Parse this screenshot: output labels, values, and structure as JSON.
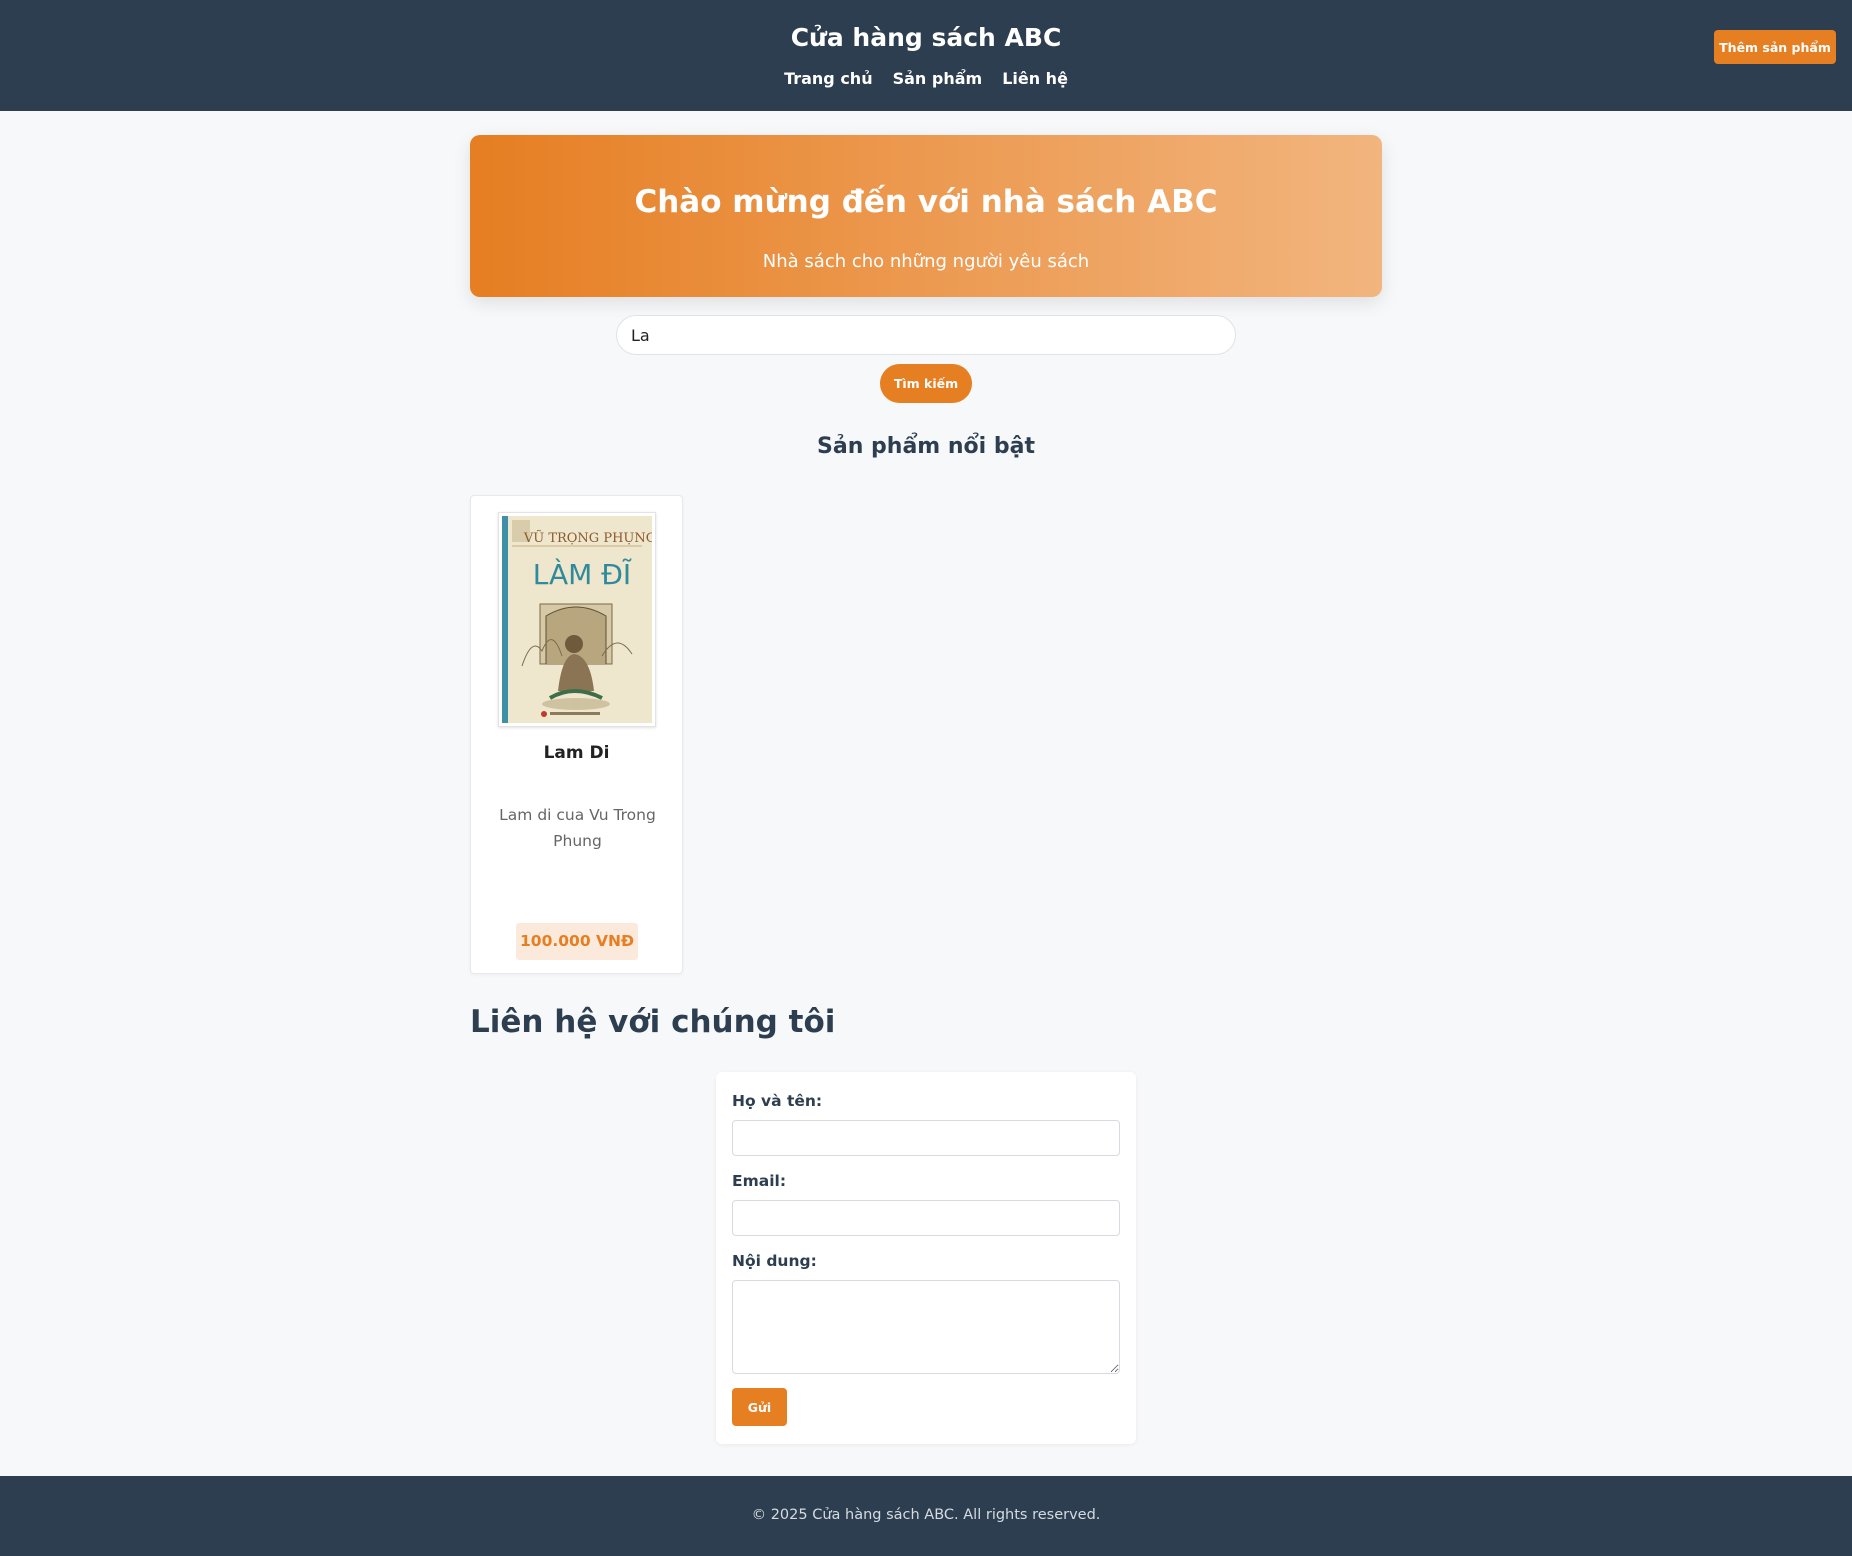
{
  "header": {
    "site_title": "Cửa hàng sách ABC",
    "nav": [
      "Trang chủ",
      "Sản phẩm",
      "Liên hệ"
    ],
    "add_product_label": "Thêm sản phẩm"
  },
  "hero": {
    "title": "Chào mừng đến với nhà sách ABC",
    "subtitle": "Nhà sách cho những người yêu sách"
  },
  "search": {
    "value": "La",
    "button_label": "Tìm kiếm"
  },
  "featured": {
    "title": "Sản phẩm nổi bật",
    "products": [
      {
        "name": "Lam Di",
        "description": "Lam di cua Vu Trong Phung",
        "price": "100.000 VNĐ",
        "cover": {
          "author": "VŨ TRỌNG PHỤNG",
          "title": "LÀM ĐĨ"
        }
      }
    ]
  },
  "contact": {
    "title": "Liên hệ với chúng tôi",
    "name_label": "Họ và tên:",
    "name_value": "",
    "email_label": "Email:",
    "email_value": "",
    "message_label": "Nội dung:",
    "message_value": "",
    "submit_label": "Gửi"
  },
  "footer": {
    "text": "© 2025 Cửa hàng sách ABC. All rights reserved."
  },
  "colors": {
    "header_bg": "#2d3e50",
    "accent": "#e67e22",
    "hero_gradient_end": "#f2b57e",
    "page_bg": "#f7f8fa"
  }
}
